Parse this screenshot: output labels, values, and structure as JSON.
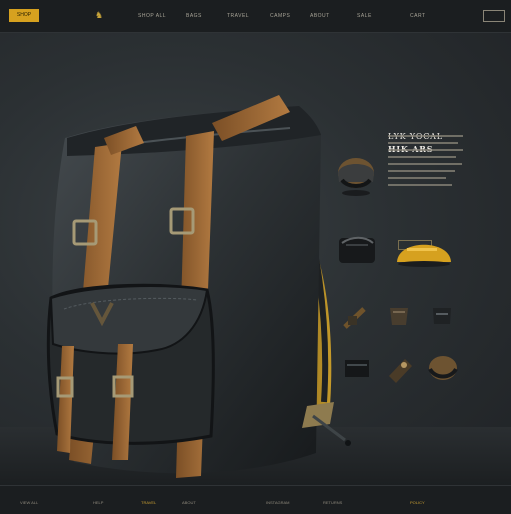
{
  "header": {
    "button_label": "SHOP",
    "nav": [
      "SHOP ALL",
      "BAGS",
      "TRAVEL",
      "CAMPS",
      "ABOUT",
      "SALE",
      "CART"
    ]
  },
  "hero": {
    "title_line1": "LYK YOCAL",
    "title_line2": "HIK ARS"
  },
  "footer": {
    "items": [
      "VIEW ALL",
      "HELP",
      "TRAVEL",
      "ABOUT",
      "INSTAGRAM",
      "RETURNS",
      "POLICY"
    ]
  },
  "colors": {
    "accent": "#d6a11f",
    "strap": "#9b6734",
    "bag": "#2b3033"
  }
}
